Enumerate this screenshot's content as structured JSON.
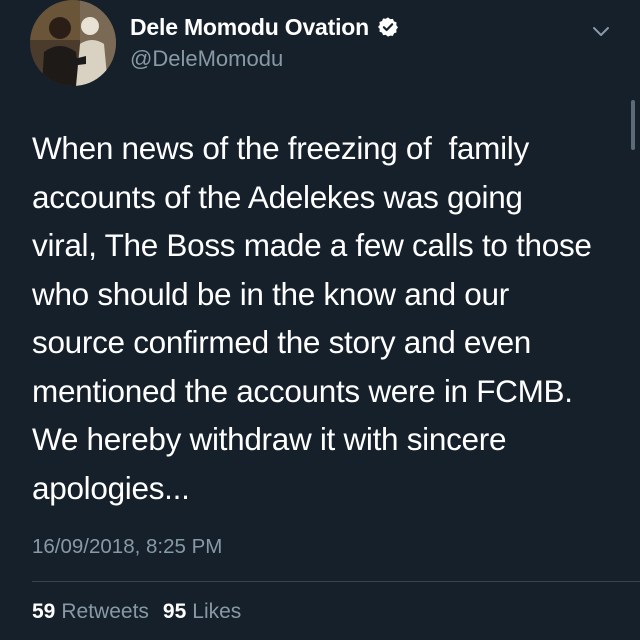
{
  "author": {
    "display_name": "Dele Momodu Ovation",
    "handle": "@DeleMomodu",
    "verified_icon": "verified-badge-icon",
    "avatar_icon": "avatar-photo"
  },
  "menu": {
    "icon": "chevron-down-icon"
  },
  "tweet": {
    "text": "When news of the freezing of  family\naccounts of the Adelekes was going\nviral, The Boss made a few calls to those\nwho should be in the know and our\nsource confirmed the story and even\nmentioned the accounts were in FCMB.\nWe hereby withdraw it with sincere\napologies...",
    "timestamp": "16/09/2018, 8:25 PM"
  },
  "stats": {
    "retweets_count": "59",
    "retweets_label": "Retweets",
    "likes_count": "95",
    "likes_label": "Likes"
  },
  "colors": {
    "background": "#15202b",
    "text": "#ffffff",
    "secondary_text": "#8899a6",
    "divider": "#38444d",
    "verified_badge": "#ffffff"
  }
}
